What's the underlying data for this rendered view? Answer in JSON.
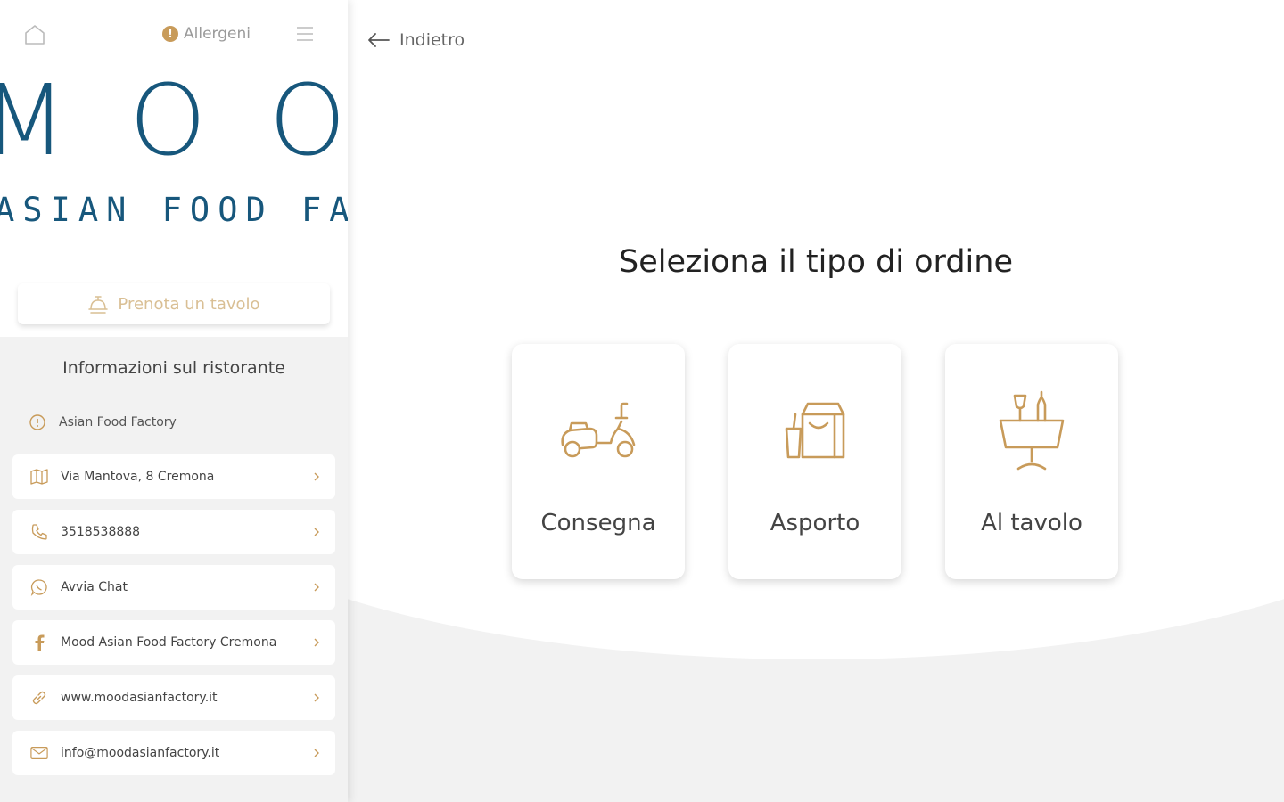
{
  "sidebar": {
    "allergeni_label": "Allergeni",
    "info_glyph": "!",
    "logo_word": "MOOD",
    "logo_sub": "ASIAN FOOD FACTORY",
    "reserve_label": "Prenota un tavolo",
    "info_title": "Informazioni sul ristorante",
    "restaurant_name": "Asian Food Factory",
    "items": [
      {
        "icon": "map-icon",
        "label": "Via Mantova, 8 Cremona"
      },
      {
        "icon": "phone-icon",
        "label": "3518538888"
      },
      {
        "icon": "whatsapp-icon",
        "label": "Avvia Chat"
      },
      {
        "icon": "facebook-icon",
        "label": "Mood Asian Food Factory Cremona"
      },
      {
        "icon": "link-icon",
        "label": "www.moodasianfactory.it"
      },
      {
        "icon": "mail-icon",
        "label": "info@moodasianfactory.it"
      }
    ]
  },
  "main": {
    "back_label": "Indietro",
    "heading": "Seleziona il tipo di ordine",
    "options": [
      {
        "icon": "scooter-icon",
        "label": "Consegna"
      },
      {
        "icon": "takeaway-bag-icon",
        "label": "Asporto"
      },
      {
        "icon": "table-icon",
        "label": "Al tavolo"
      }
    ]
  },
  "colors": {
    "brand_blue": "#17577c",
    "accent_gold": "#c89b5a",
    "background": "#f2f2f2"
  }
}
